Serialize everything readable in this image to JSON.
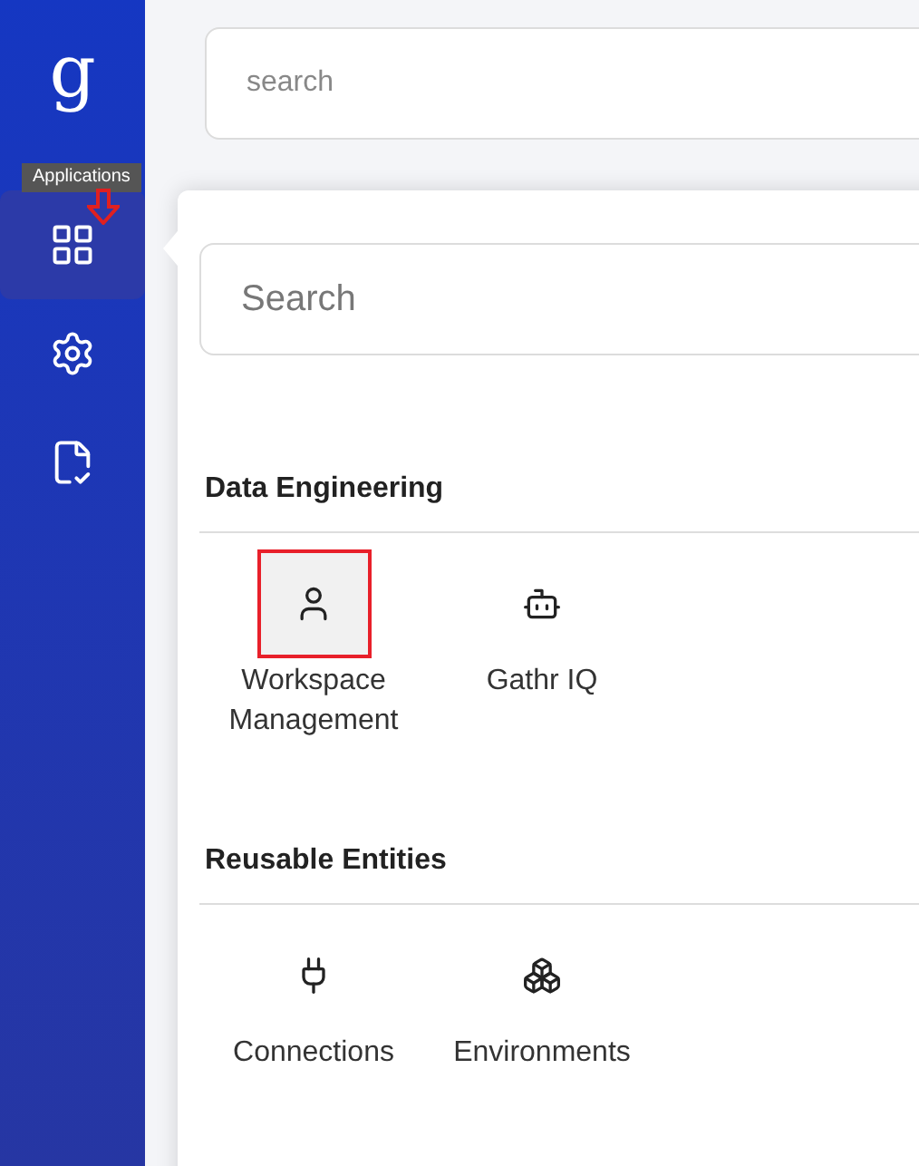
{
  "sidebar": {
    "logo": "g",
    "tooltip": "Applications",
    "items": [
      {
        "kind": "apps",
        "selected": true
      },
      {
        "kind": "settings",
        "selected": false
      },
      {
        "kind": "report",
        "selected": false
      }
    ]
  },
  "top_search": {
    "placeholder": "search"
  },
  "panel": {
    "search": {
      "placeholder": "Search"
    },
    "sections": [
      {
        "title": "Data Engineering",
        "apps": [
          {
            "kind": "user",
            "label": "Workspace Management",
            "selected": true
          },
          {
            "kind": "robot",
            "label": "Gathr IQ",
            "selected": false
          }
        ]
      },
      {
        "title": "Reusable Entities",
        "apps": [
          {
            "kind": "plug",
            "label": "Connections",
            "selected": false
          },
          {
            "kind": "boxes",
            "label": "Environments",
            "selected": false
          }
        ]
      }
    ]
  }
}
